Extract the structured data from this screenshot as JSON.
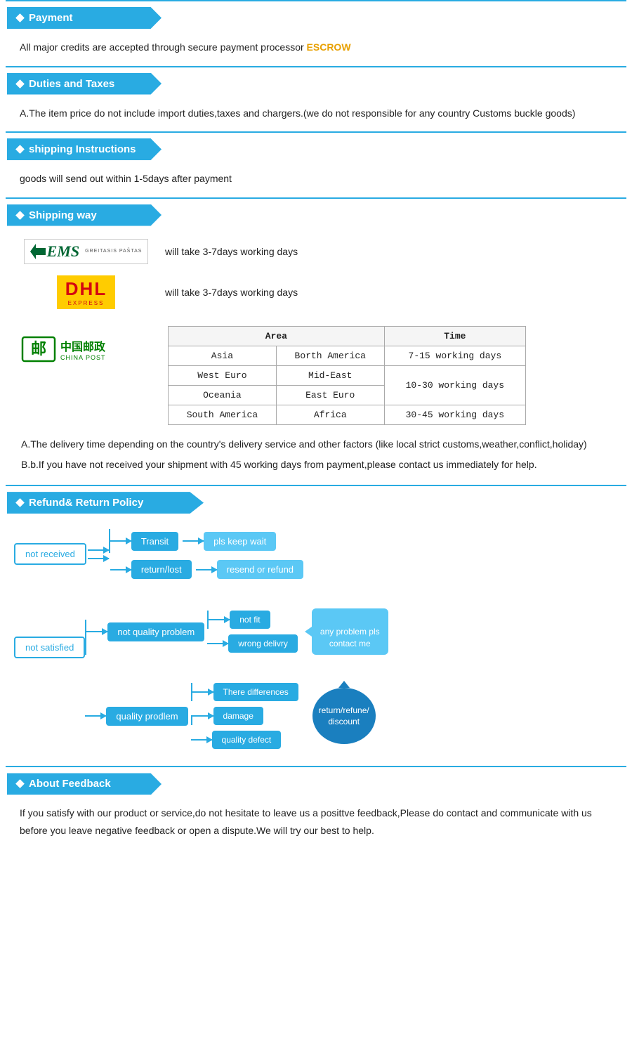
{
  "payment": {
    "header": "Payment",
    "body": "All  major  credits  are  accepted  through  secure  payment  processor",
    "escrow": "ESCROW"
  },
  "duties": {
    "header": "Duties  and  Taxes",
    "body": "A.The  item  price  do  not  include  import  duties,taxes  and  chargers.(we  do  not  responsible  for  any  country  Customs  buckle  goods)"
  },
  "shipping_instructions": {
    "header": "shipping  Instructions",
    "body": "goods  will  send  out  within  1-5days  after  payment"
  },
  "shipping_way": {
    "header": "Shipping  way",
    "ems_label": "will  take  3-7days  working  days",
    "dhl_label": "will  take  3-7days  working  days",
    "table": {
      "headers": [
        "Area",
        "Time"
      ],
      "sub_headers": [
        "",
        ""
      ],
      "rows": [
        {
          "col1": "Asia",
          "col2": "Borth America",
          "col3": "7-15 working days"
        },
        {
          "col1": "West Euro",
          "col2": "Mid-East",
          "col3": "10-30 working days"
        },
        {
          "col1": "Oceania",
          "col2": "East Euro",
          "col3": ""
        },
        {
          "col1": "South America",
          "col2": "Africa",
          "col3": "30-45 working days"
        }
      ]
    },
    "note1": "A.The  delivery  time  depending  on  the  country's  delivery  service  and  other  factors  (like  local  strict   customs,weather,conflict,holiday)",
    "note2": "B.b.If  you  have  not  received  your  shipment  with  45  working  days  from  payment,please  contact  us   immediately  for  help."
  },
  "refund": {
    "header": "Refund&  Return  Policy",
    "not_received": "not  received",
    "transit": "Transit",
    "return_lost": "return/lost",
    "pls_keep_wait": "pls  keep  wait",
    "resend_or_refund": "resend  or  refund",
    "not_satisfied": "not  satisfied",
    "not_quality_problem": "not  quality  problem",
    "not_fit": "not  fit",
    "wrong_delivery": "wrong  delivry",
    "there_differences": "There  differences",
    "quality_prodlem": "quality  prodlem",
    "damage": "damage",
    "quality_defect": "quality  defect",
    "any_problem": "any  problem  pls\ncontact  me",
    "return_refund": "return/refune/\ndiscount"
  },
  "feedback": {
    "header": "About  Feedback",
    "body": "If  you  satisfy  with  our  product  or  service,do  not  hesitate  to  leave  us  a  posittve  feedback,Please  do  contact  and  communicate  with  us  before  you  leave  negative  feedback  or  open  a  dispute.We  will  try  our  best  to  help."
  },
  "colors": {
    "blue": "#29abe2",
    "red": "#e8a000",
    "green": "#008000"
  }
}
